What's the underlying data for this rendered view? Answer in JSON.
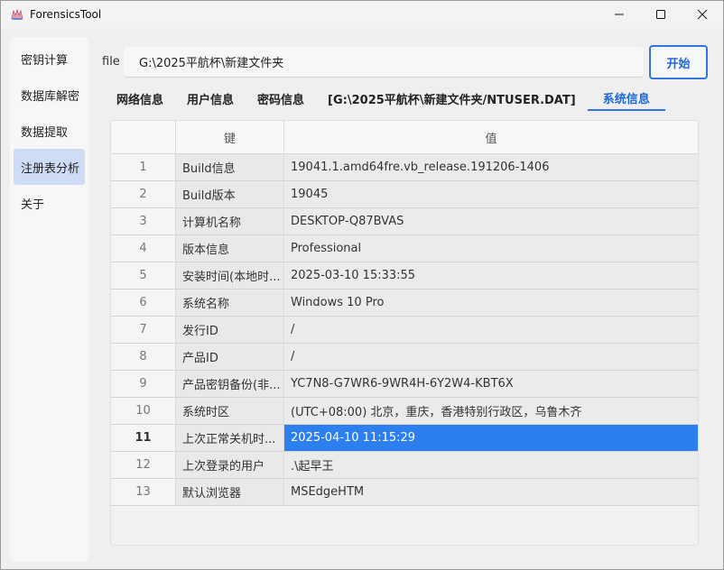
{
  "window": {
    "title": "ForensicsTool",
    "icon": "app-logo-icon",
    "controls": [
      "minimize-icon",
      "maximize-icon",
      "close-icon"
    ]
  },
  "sidebar": {
    "items": [
      {
        "label": "密钥计算",
        "active": false
      },
      {
        "label": "数据库解密",
        "active": false
      },
      {
        "label": "数据提取",
        "active": false
      },
      {
        "label": "注册表分析",
        "active": true
      },
      {
        "label": "关于",
        "active": false
      }
    ]
  },
  "file": {
    "label": "file",
    "value": "G:\\2025平航杯\\新建文件夹"
  },
  "start_button": "开始",
  "tabs": [
    {
      "label": "网络信息",
      "active": false
    },
    {
      "label": "用户信息",
      "active": false
    },
    {
      "label": "密码信息",
      "active": false
    },
    {
      "label": "[G:\\2025平航杯\\新建文件夹/NTUSER.DAT]",
      "active": false
    },
    {
      "label": "系统信息",
      "active": true
    }
  ],
  "table": {
    "headers": {
      "key": "键",
      "value": "值"
    },
    "selected_row": 11,
    "rows": [
      {
        "idx": "1",
        "key": "Build信息",
        "value": "19041.1.amd64fre.vb_release.191206-1406"
      },
      {
        "idx": "2",
        "key": "Build版本",
        "value": "19045"
      },
      {
        "idx": "3",
        "key": "计算机名称",
        "value": "DESKTOP-Q87BVAS"
      },
      {
        "idx": "4",
        "key": "版本信息",
        "value": "Professional"
      },
      {
        "idx": "5",
        "key": "安装时间(本地时...",
        "value": "2025-03-10 15:33:55"
      },
      {
        "idx": "6",
        "key": "系统名称",
        "value": "Windows 10 Pro"
      },
      {
        "idx": "7",
        "key": "发行ID",
        "value": "/"
      },
      {
        "idx": "8",
        "key": "产品ID",
        "value": "/"
      },
      {
        "idx": "9",
        "key": "产品密钥备份(非...",
        "value": "YC7N8-G7WR6-9WR4H-6Y2W4-KBT6X"
      },
      {
        "idx": "10",
        "key": "系统时区",
        "value": "(UTC+08:00) 北京，重庆，香港特别行政区，乌鲁木齐"
      },
      {
        "idx": "11",
        "key": "上次正常关机时...",
        "value": "2025-04-10 11:15:29"
      },
      {
        "idx": "12",
        "key": "上次登录的用户",
        "value": ".\\起早王"
      },
      {
        "idx": "13",
        "key": "默认浏览器",
        "value": "MSEdgeHTM"
      }
    ]
  },
  "colors": {
    "accent": "#2f77e0",
    "selected_row": "#2d7ff0",
    "active_nav": "#cfdcf5"
  }
}
